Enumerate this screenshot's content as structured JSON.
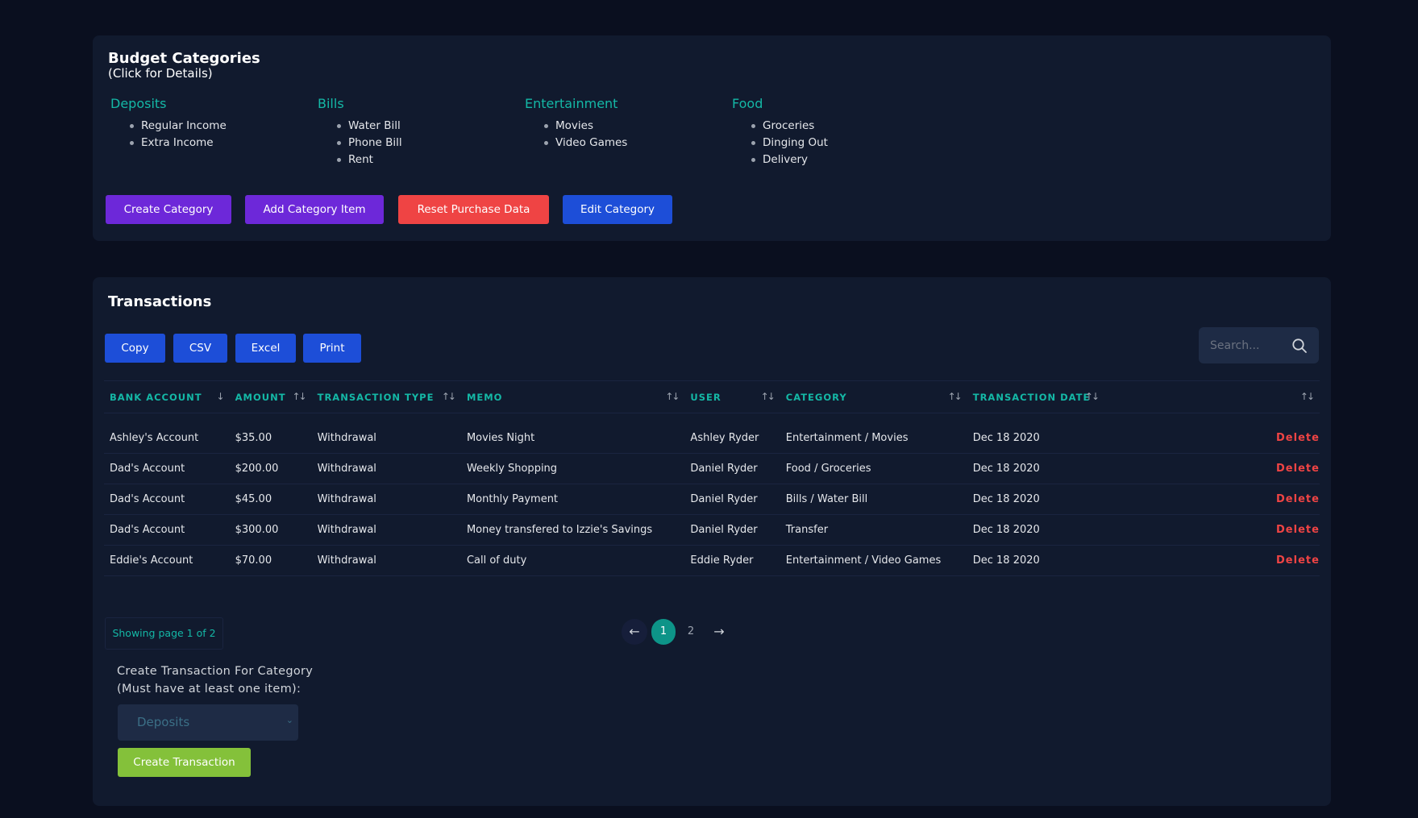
{
  "budget": {
    "title": "Budget Categories",
    "subtitle": "(Click for Details)",
    "categories": [
      {
        "name": "Deposits",
        "items": [
          "Regular Income",
          "Extra Income"
        ]
      },
      {
        "name": "Bills",
        "items": [
          "Water Bill",
          "Phone Bill",
          "Rent"
        ]
      },
      {
        "name": "Entertainment",
        "items": [
          "Movies",
          "Video Games"
        ]
      },
      {
        "name": "Food",
        "items": [
          "Groceries",
          "Dinging Out",
          "Delivery"
        ]
      }
    ],
    "buttons": {
      "create_category": "Create Category",
      "add_category_item": "Add Category Item",
      "reset_purchase_data": "Reset Purchase Data",
      "edit_category": "Edit Category"
    }
  },
  "transactions": {
    "title": "Transactions",
    "export_buttons": {
      "copy": "Copy",
      "csv": "CSV",
      "excel": "Excel",
      "print": "Print"
    },
    "search": {
      "placeholder": "Search..."
    },
    "columns": [
      "BANK ACCOUNT",
      "AMOUNT",
      "TRANSACTION TYPE",
      "MEMO",
      "USER",
      "CATEGORY",
      "TRANSACTION DATE"
    ],
    "sort_icons": {
      "active_desc": "↓",
      "unsorted": "↑↓"
    },
    "delete_label": "Delete",
    "rows": [
      {
        "bank_account": "Ashley's Account",
        "amount": "$35.00",
        "type": "Withdrawal",
        "memo": "Movies Night",
        "user": "Ashley Ryder",
        "category": "Entertainment / Movies",
        "date": "Dec 18 2020"
      },
      {
        "bank_account": "Dad's Account",
        "amount": "$200.00",
        "type": "Withdrawal",
        "memo": "Weekly Shopping",
        "user": "Daniel Ryder",
        "category": "Food / Groceries",
        "date": "Dec 18 2020"
      },
      {
        "bank_account": "Dad's Account",
        "amount": "$45.00",
        "type": "Withdrawal",
        "memo": "Monthly Payment",
        "user": "Daniel Ryder",
        "category": "Bills / Water Bill",
        "date": "Dec 18 2020"
      },
      {
        "bank_account": "Dad's Account",
        "amount": "$300.00",
        "type": "Withdrawal",
        "memo": "Money transfered to Izzie's Savings",
        "user": "Daniel Ryder",
        "category": "Transfer",
        "date": "Dec 18 2020"
      },
      {
        "bank_account": "Eddie's Account",
        "amount": "$70.00",
        "type": "Withdrawal",
        "memo": "Call of duty",
        "user": "Eddie Ryder",
        "category": "Entertainment / Video Games",
        "date": "Dec 18 2020"
      }
    ],
    "page_info": "Showing page 1 of 2",
    "pagination": {
      "prev": "←",
      "pages": [
        "1",
        "2"
      ],
      "current": "1",
      "next": "→"
    }
  },
  "create_transaction": {
    "label_line1": "Create Transaction For Category",
    "label_line2": "(Must have at least one item):",
    "selected_category": "Deposits",
    "button": "Create Transaction"
  },
  "colors": {
    "background": "#0a0f1f",
    "card": "#111a2e",
    "accent_teal": "#14b8a6",
    "purple": "#6d28d9",
    "red": "#ef4444",
    "blue": "#1d4ed8",
    "green": "#84c13a"
  },
  "icons": {
    "search": "search-icon",
    "select_chevron": "chevron-down-icon"
  }
}
